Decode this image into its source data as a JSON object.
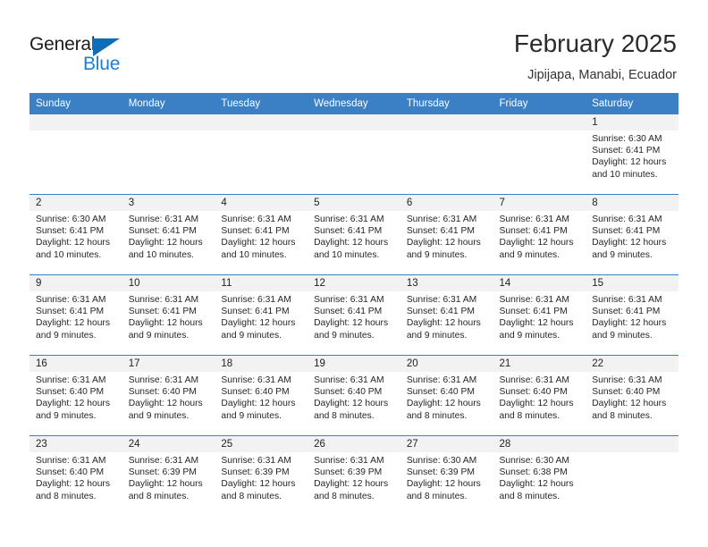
{
  "brand": {
    "word_one": "General",
    "word_two": "Blue",
    "accent_color": "#0f6cb6",
    "accent_color_light": "#1a7fd4",
    "triangle_icon": "triangle-icon"
  },
  "header": {
    "title": "February 2025",
    "subtitle": "Jipijapa, Manabi, Ecuador"
  },
  "theme": {
    "header_row_bg": "#3b7fc4",
    "day_band_bg": "#f2f2f2",
    "text_color": "#262626"
  },
  "calendar": {
    "weekday_headers": [
      "Sunday",
      "Monday",
      "Tuesday",
      "Wednesday",
      "Thursday",
      "Friday",
      "Saturday"
    ],
    "weeks": [
      [
        {
          "day": "",
          "sunrise": "",
          "sunset": "",
          "daylight_line1": "",
          "daylight_line2": ""
        },
        {
          "day": "",
          "sunrise": "",
          "sunset": "",
          "daylight_line1": "",
          "daylight_line2": ""
        },
        {
          "day": "",
          "sunrise": "",
          "sunset": "",
          "daylight_line1": "",
          "daylight_line2": ""
        },
        {
          "day": "",
          "sunrise": "",
          "sunset": "",
          "daylight_line1": "",
          "daylight_line2": ""
        },
        {
          "day": "",
          "sunrise": "",
          "sunset": "",
          "daylight_line1": "",
          "daylight_line2": ""
        },
        {
          "day": "",
          "sunrise": "",
          "sunset": "",
          "daylight_line1": "",
          "daylight_line2": ""
        },
        {
          "day": "1",
          "sunrise": "Sunrise: 6:30 AM",
          "sunset": "Sunset: 6:41 PM",
          "daylight_line1": "Daylight: 12 hours",
          "daylight_line2": "and 10 minutes."
        }
      ],
      [
        {
          "day": "2",
          "sunrise": "Sunrise: 6:30 AM",
          "sunset": "Sunset: 6:41 PM",
          "daylight_line1": "Daylight: 12 hours",
          "daylight_line2": "and 10 minutes."
        },
        {
          "day": "3",
          "sunrise": "Sunrise: 6:31 AM",
          "sunset": "Sunset: 6:41 PM",
          "daylight_line1": "Daylight: 12 hours",
          "daylight_line2": "and 10 minutes."
        },
        {
          "day": "4",
          "sunrise": "Sunrise: 6:31 AM",
          "sunset": "Sunset: 6:41 PM",
          "daylight_line1": "Daylight: 12 hours",
          "daylight_line2": "and 10 minutes."
        },
        {
          "day": "5",
          "sunrise": "Sunrise: 6:31 AM",
          "sunset": "Sunset: 6:41 PM",
          "daylight_line1": "Daylight: 12 hours",
          "daylight_line2": "and 10 minutes."
        },
        {
          "day": "6",
          "sunrise": "Sunrise: 6:31 AM",
          "sunset": "Sunset: 6:41 PM",
          "daylight_line1": "Daylight: 12 hours",
          "daylight_line2": "and 9 minutes."
        },
        {
          "day": "7",
          "sunrise": "Sunrise: 6:31 AM",
          "sunset": "Sunset: 6:41 PM",
          "daylight_line1": "Daylight: 12 hours",
          "daylight_line2": "and 9 minutes."
        },
        {
          "day": "8",
          "sunrise": "Sunrise: 6:31 AM",
          "sunset": "Sunset: 6:41 PM",
          "daylight_line1": "Daylight: 12 hours",
          "daylight_line2": "and 9 minutes."
        }
      ],
      [
        {
          "day": "9",
          "sunrise": "Sunrise: 6:31 AM",
          "sunset": "Sunset: 6:41 PM",
          "daylight_line1": "Daylight: 12 hours",
          "daylight_line2": "and 9 minutes."
        },
        {
          "day": "10",
          "sunrise": "Sunrise: 6:31 AM",
          "sunset": "Sunset: 6:41 PM",
          "daylight_line1": "Daylight: 12 hours",
          "daylight_line2": "and 9 minutes."
        },
        {
          "day": "11",
          "sunrise": "Sunrise: 6:31 AM",
          "sunset": "Sunset: 6:41 PM",
          "daylight_line1": "Daylight: 12 hours",
          "daylight_line2": "and 9 minutes."
        },
        {
          "day": "12",
          "sunrise": "Sunrise: 6:31 AM",
          "sunset": "Sunset: 6:41 PM",
          "daylight_line1": "Daylight: 12 hours",
          "daylight_line2": "and 9 minutes."
        },
        {
          "day": "13",
          "sunrise": "Sunrise: 6:31 AM",
          "sunset": "Sunset: 6:41 PM",
          "daylight_line1": "Daylight: 12 hours",
          "daylight_line2": "and 9 minutes."
        },
        {
          "day": "14",
          "sunrise": "Sunrise: 6:31 AM",
          "sunset": "Sunset: 6:41 PM",
          "daylight_line1": "Daylight: 12 hours",
          "daylight_line2": "and 9 minutes."
        },
        {
          "day": "15",
          "sunrise": "Sunrise: 6:31 AM",
          "sunset": "Sunset: 6:41 PM",
          "daylight_line1": "Daylight: 12 hours",
          "daylight_line2": "and 9 minutes."
        }
      ],
      [
        {
          "day": "16",
          "sunrise": "Sunrise: 6:31 AM",
          "sunset": "Sunset: 6:40 PM",
          "daylight_line1": "Daylight: 12 hours",
          "daylight_line2": "and 9 minutes."
        },
        {
          "day": "17",
          "sunrise": "Sunrise: 6:31 AM",
          "sunset": "Sunset: 6:40 PM",
          "daylight_line1": "Daylight: 12 hours",
          "daylight_line2": "and 9 minutes."
        },
        {
          "day": "18",
          "sunrise": "Sunrise: 6:31 AM",
          "sunset": "Sunset: 6:40 PM",
          "daylight_line1": "Daylight: 12 hours",
          "daylight_line2": "and 9 minutes."
        },
        {
          "day": "19",
          "sunrise": "Sunrise: 6:31 AM",
          "sunset": "Sunset: 6:40 PM",
          "daylight_line1": "Daylight: 12 hours",
          "daylight_line2": "and 8 minutes."
        },
        {
          "day": "20",
          "sunrise": "Sunrise: 6:31 AM",
          "sunset": "Sunset: 6:40 PM",
          "daylight_line1": "Daylight: 12 hours",
          "daylight_line2": "and 8 minutes."
        },
        {
          "day": "21",
          "sunrise": "Sunrise: 6:31 AM",
          "sunset": "Sunset: 6:40 PM",
          "daylight_line1": "Daylight: 12 hours",
          "daylight_line2": "and 8 minutes."
        },
        {
          "day": "22",
          "sunrise": "Sunrise: 6:31 AM",
          "sunset": "Sunset: 6:40 PM",
          "daylight_line1": "Daylight: 12 hours",
          "daylight_line2": "and 8 minutes."
        }
      ],
      [
        {
          "day": "23",
          "sunrise": "Sunrise: 6:31 AM",
          "sunset": "Sunset: 6:40 PM",
          "daylight_line1": "Daylight: 12 hours",
          "daylight_line2": "and 8 minutes."
        },
        {
          "day": "24",
          "sunrise": "Sunrise: 6:31 AM",
          "sunset": "Sunset: 6:39 PM",
          "daylight_line1": "Daylight: 12 hours",
          "daylight_line2": "and 8 minutes."
        },
        {
          "day": "25",
          "sunrise": "Sunrise: 6:31 AM",
          "sunset": "Sunset: 6:39 PM",
          "daylight_line1": "Daylight: 12 hours",
          "daylight_line2": "and 8 minutes."
        },
        {
          "day": "26",
          "sunrise": "Sunrise: 6:31 AM",
          "sunset": "Sunset: 6:39 PM",
          "daylight_line1": "Daylight: 12 hours",
          "daylight_line2": "and 8 minutes."
        },
        {
          "day": "27",
          "sunrise": "Sunrise: 6:30 AM",
          "sunset": "Sunset: 6:39 PM",
          "daylight_line1": "Daylight: 12 hours",
          "daylight_line2": "and 8 minutes."
        },
        {
          "day": "28",
          "sunrise": "Sunrise: 6:30 AM",
          "sunset": "Sunset: 6:38 PM",
          "daylight_line1": "Daylight: 12 hours",
          "daylight_line2": "and 8 minutes."
        },
        {
          "day": "",
          "sunrise": "",
          "sunset": "",
          "daylight_line1": "",
          "daylight_line2": ""
        }
      ]
    ]
  }
}
